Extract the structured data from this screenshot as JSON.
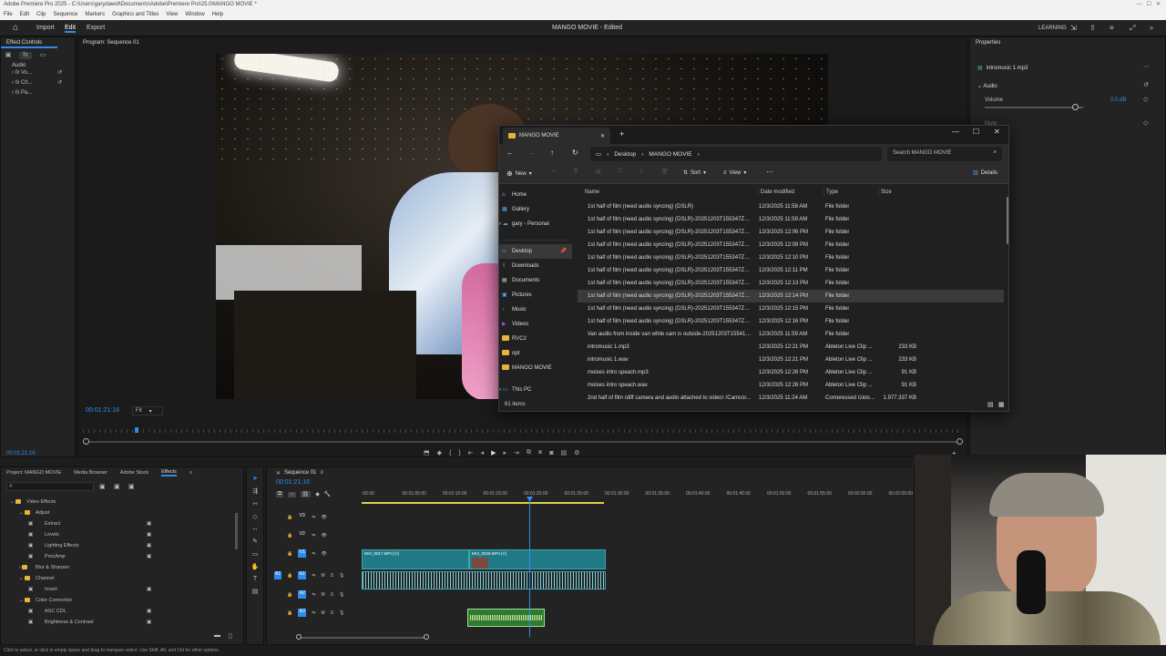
{
  "window_title": "Adobe Premiere Pro 2025 - C:\\Users\\garydawid\\Documents\\Adobe\\Premiere Pro\\25.0\\MANGO MOVIE *",
  "menu": [
    "File",
    "Edit",
    "Clip",
    "Sequence",
    "Markers",
    "Graphics and Titles",
    "View",
    "Window",
    "Help"
  ],
  "header": {
    "home_icon": "home-icon",
    "import": "Import",
    "edit": "Edit",
    "export": "Export",
    "project_title": "MANGO MOVIE - Edited",
    "learning": "LEARNING"
  },
  "effect_controls": {
    "title": "Effect Controls",
    "section": "Audio",
    "effects": [
      "Vo...",
      "Ch...",
      "Pa..."
    ],
    "timecode": "00:01:21:16"
  },
  "program_monitor": {
    "title": "Program: Sequence 01",
    "timecode": "00:01:21:16",
    "fit": "Fit"
  },
  "properties": {
    "title": "Properties",
    "file": "intromusic 1.mp3",
    "section": "Audio",
    "volume_label": "Volume",
    "volume_value": "0.0 dB",
    "mute_label": "Mute"
  },
  "explorer": {
    "tab_title": "MANGO MOVIE",
    "breadcrumb": [
      "Desktop",
      "MANGO MOVIE"
    ],
    "search_placeholder": "Search MANGO MOVIE",
    "toolbar": {
      "new": "New",
      "sort": "Sort",
      "view": "View",
      "details": "Details"
    },
    "nav": [
      "Home",
      "Gallery",
      "gary - Personal",
      "Desktop",
      "Downloads",
      "Documents",
      "Pictures",
      "Music",
      "Videos",
      "RVC2",
      "opt",
      "MANGO MOVIE",
      "This PC"
    ],
    "columns": [
      "Name",
      "Date modified",
      "Type",
      "Size"
    ],
    "rows": [
      {
        "name": "1st half of film (need audio syncing) (DSLR)",
        "date": "12/3/2025 11:58 AM",
        "type": "File folder",
        "size": "",
        "kind": "folder"
      },
      {
        "name": "1st half of film (need audio syncing) (DSLR)-20251203T155347Z-1-0...",
        "date": "12/3/2025 11:59 AM",
        "type": "File folder",
        "size": "",
        "kind": "folder"
      },
      {
        "name": "1st half of film (need audio syncing) (DSLR)-20251203T155347Z-1-0...",
        "date": "12/3/2025 12:06 PM",
        "type": "File folder",
        "size": "",
        "kind": "folder"
      },
      {
        "name": "1st half of film (need audio syncing) (DSLR)-20251203T155347Z-1-0...",
        "date": "12/3/2025 12:09 PM",
        "type": "File folder",
        "size": "",
        "kind": "folder"
      },
      {
        "name": "1st half of film (need audio syncing) (DSLR)-20251203T155347Z-1-0...",
        "date": "12/3/2025 12:10 PM",
        "type": "File folder",
        "size": "",
        "kind": "folder"
      },
      {
        "name": "1st half of film (need audio syncing) (DSLR)-20251203T155347Z-1-0...",
        "date": "12/3/2025 12:11 PM",
        "type": "File folder",
        "size": "",
        "kind": "folder"
      },
      {
        "name": "1st half of film (need audio syncing) (DSLR)-20251203T155347Z-1-0...",
        "date": "12/3/2025 12:13 PM",
        "type": "File folder",
        "size": "",
        "kind": "folder"
      },
      {
        "name": "1st half of film (need audio syncing) (DSLR)-20251203T155347Z-1-0...",
        "date": "12/3/2025 12:14 PM",
        "type": "File folder",
        "size": "",
        "kind": "folder"
      },
      {
        "name": "1st half of film (need audio syncing) (DSLR)-20251203T155347Z-1-0...",
        "date": "12/3/2025 12:15 PM",
        "type": "File folder",
        "size": "",
        "kind": "folder"
      },
      {
        "name": "1st half of film (need audio syncing) (DSLR)-20251203T155347Z-1-0...",
        "date": "12/3/2025 12:16 PM",
        "type": "File folder",
        "size": "",
        "kind": "folder"
      },
      {
        "name": "Van audio from inside van while cam is outside-20251203T155412Z...",
        "date": "12/3/2025 11:59 AM",
        "type": "File folder",
        "size": "",
        "kind": "folder"
      },
      {
        "name": "intromusic 1.mp3",
        "date": "12/3/2025 12:21 PM",
        "type": "Ableton Live Clip ...",
        "size": "233 KB",
        "kind": "file"
      },
      {
        "name": "intromusic 1.wav",
        "date": "12/3/2025 12:21 PM",
        "type": "Ableton Live Clip ...",
        "size": "233 KB",
        "kind": "file"
      },
      {
        "name": "moises intro speach.mp3",
        "date": "12/3/2025 12:26 PM",
        "type": "Ableton Live Clip ...",
        "size": "91 KB",
        "kind": "file"
      },
      {
        "name": "moises intro speach.wav",
        "date": "12/3/2025 12:26 PM",
        "type": "Ableton Live Clip ...",
        "size": "91 KB",
        "kind": "file"
      },
      {
        "name": "2nd half of film (diff camera and audio attached to video) (Camcor...",
        "date": "12/3/2025 11:24 AM",
        "type": "Compressed (zipp...",
        "size": "1,977,337 KB",
        "kind": "zip"
      }
    ],
    "status": "61 items"
  },
  "project": {
    "tabs": [
      "Project: MANGO MOVIE",
      "Media Browser",
      "Adobe Stock",
      "Effects"
    ],
    "tree": [
      {
        "label": "Video Effects",
        "level": 0
      },
      {
        "label": "Adjust",
        "level": 1
      },
      {
        "label": "Extract",
        "level": 2
      },
      {
        "label": "Levels",
        "level": 2
      },
      {
        "label": "Lighting Effects",
        "level": 2
      },
      {
        "label": "ProcAmp",
        "level": 2
      },
      {
        "label": "Blur & Sharpen",
        "level": 1
      },
      {
        "label": "Channel",
        "level": 1
      },
      {
        "label": "Invert",
        "level": 2
      },
      {
        "label": "Color Correction",
        "level": 1
      },
      {
        "label": "ASC CDL",
        "level": 2
      },
      {
        "label": "Brightness & Contrast",
        "level": 2
      }
    ]
  },
  "timeline": {
    "tab": "Sequence 01",
    "timecode": "00:01:21:16",
    "ruler": [
      ":00:00",
      "00:01:05:00",
      "00:01:10:00",
      "00:01:15:00",
      "00:01:20:00",
      "00:01:25:00",
      "00:01:30:00",
      "00:01:35:00",
      "00:01:40:00",
      "00:01:45:00",
      "00:01:50:00",
      "00:01:55:00",
      "00:02:00:00",
      "00:02:05:00"
    ],
    "tracks": [
      "V3",
      "V2",
      "V1",
      "A1",
      "A2",
      "A3"
    ],
    "clips": {
      "v1a": "MVI_0017.MP4 [V]",
      "v1b": "MVI_0026.MP4 [V]"
    }
  },
  "status_bar": "Click to select, or click in empty space and drag to marquee select. Use Shift, Alt, and Ctrl for other options."
}
